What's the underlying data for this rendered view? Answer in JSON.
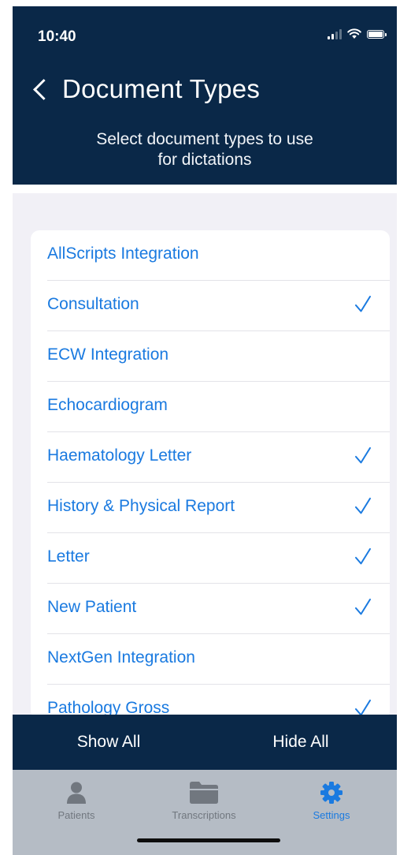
{
  "status_bar": {
    "time": "10:40"
  },
  "header": {
    "back_icon": "chevron-left-icon",
    "title": "Document Types",
    "subtitle_line1": "Select document types to use",
    "subtitle_line2": "for dictations"
  },
  "document_types": [
    {
      "label": "AllScripts Integration",
      "checked": false
    },
    {
      "label": "Consultation",
      "checked": true
    },
    {
      "label": "ECW Integration",
      "checked": false
    },
    {
      "label": "Echocardiogram",
      "checked": false
    },
    {
      "label": "Haematology Letter",
      "checked": true
    },
    {
      "label": "History & Physical Report",
      "checked": true
    },
    {
      "label": "Letter",
      "checked": true
    },
    {
      "label": "New Patient",
      "checked": true
    },
    {
      "label": "NextGen Integration",
      "checked": false
    },
    {
      "label": "Pathology Gross",
      "checked": true
    }
  ],
  "actions": {
    "show_all": "Show All",
    "hide_all": "Hide All"
  },
  "tabs": [
    {
      "label": "Patients",
      "icon": "person-icon",
      "active": false
    },
    {
      "label": "Transcriptions",
      "icon": "folder-icon",
      "active": false
    },
    {
      "label": "Settings",
      "icon": "gear-icon",
      "active": true
    }
  ],
  "colors": {
    "header_bg": "#0a2848",
    "accent": "#1a7ae0",
    "tabbar_bg": "#b5bcc5"
  }
}
